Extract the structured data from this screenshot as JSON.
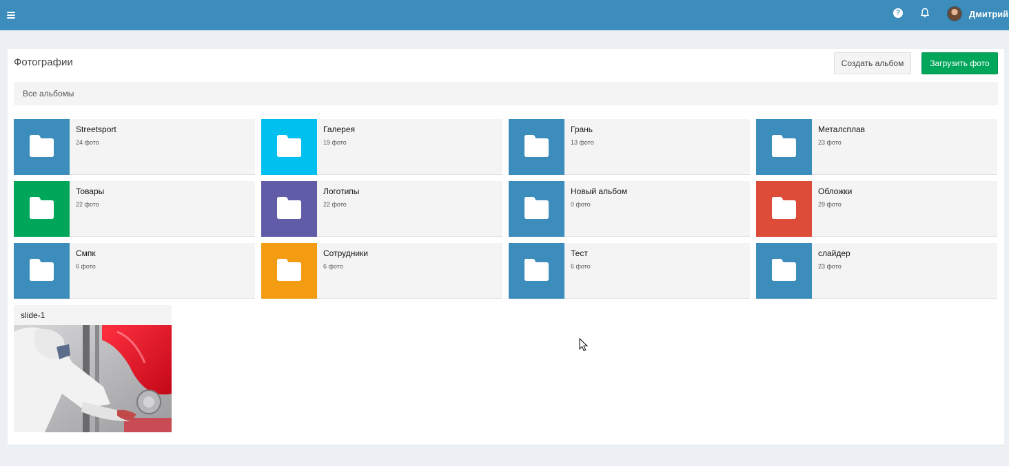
{
  "header": {
    "menu_icon": "hamburger-menu-icon",
    "help_icon": "question-circle-icon",
    "help_glyph": "?",
    "notifications_icon": "bell-icon",
    "user_name": "Дмитрий"
  },
  "page": {
    "title": "Фотографии",
    "create_album_label": "Создать альбом",
    "upload_photo_label": "Загрузить фото",
    "breadcrumb": "Все альбомы"
  },
  "albums": [
    {
      "name": "Streetsport",
      "count": "24 фото",
      "color": "#3c8dbc"
    },
    {
      "name": "Галерея",
      "count": "19 фото",
      "color": "#00c0ef"
    },
    {
      "name": "Грань",
      "count": "13 фото",
      "color": "#3c8dbc"
    },
    {
      "name": "Металсплав",
      "count": "23 фото",
      "color": "#3c8dbc"
    },
    {
      "name": "Товары",
      "count": "22 фото",
      "color": "#00a65a"
    },
    {
      "name": "Логотипы",
      "count": "22 фото",
      "color": "#605ca8"
    },
    {
      "name": "Новый альбом",
      "count": "0 фото",
      "color": "#3c8dbc"
    },
    {
      "name": "Обложки",
      "count": "29 фото",
      "color": "#dd4b39"
    },
    {
      "name": "Смпк",
      "count": "6 фото",
      "color": "#3c8dbc"
    },
    {
      "name": "Сотрудники",
      "count": "6 фото",
      "color": "#f39c12"
    },
    {
      "name": "Тест",
      "count": "6 фото",
      "color": "#3c8dbc"
    },
    {
      "name": "слайдер",
      "count": "23 фото",
      "color": "#3c8dbc"
    }
  ],
  "photos": [
    {
      "title": "slide-1",
      "image": "painter-spraying-red-car-photo"
    }
  ],
  "colors": {
    "topbar": "#3c8dbc",
    "success": "#00a65a",
    "background": "#ecf0f5"
  }
}
